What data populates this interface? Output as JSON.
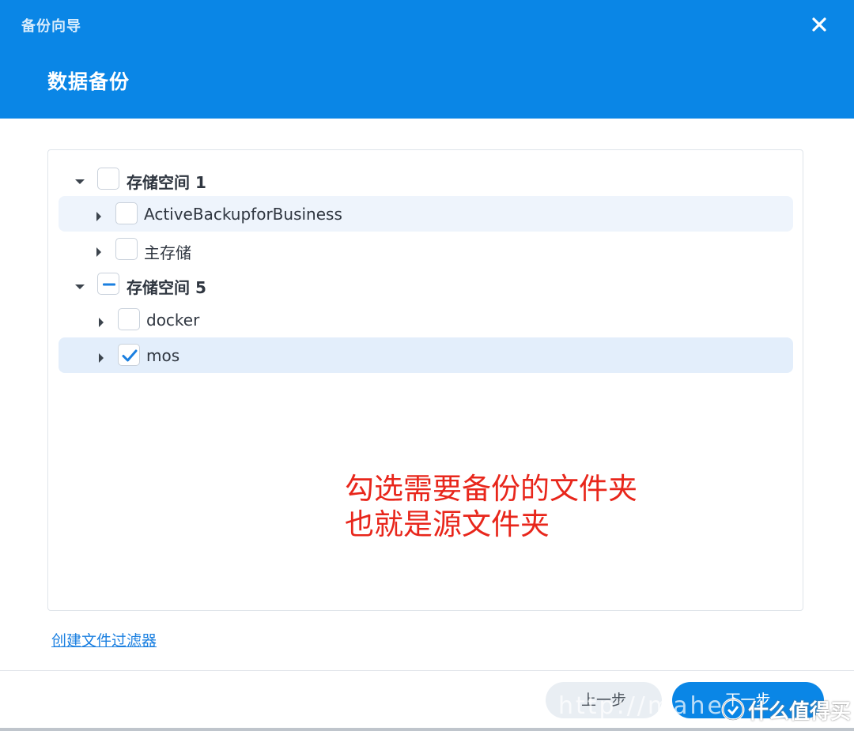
{
  "window": {
    "wizard_title": "备份向导",
    "page_title": "数据备份",
    "close_icon": "close-icon"
  },
  "tree": {
    "groups": [
      {
        "label": "存储空间 1",
        "expanded": true,
        "check_state": "unchecked",
        "children": [
          {
            "label": "ActiveBackupforBusiness",
            "check_state": "unchecked",
            "highlighted": true
          },
          {
            "label": "主存储",
            "check_state": "unchecked",
            "highlighted": false
          }
        ]
      },
      {
        "label": "存储空间 5",
        "expanded": true,
        "check_state": "partial",
        "children": [
          {
            "label": "docker",
            "check_state": "unchecked",
            "highlighted": false
          },
          {
            "label": "mos",
            "check_state": "checked",
            "highlighted": true
          }
        ]
      }
    ]
  },
  "annotation": {
    "line1": "勾选需要备份的文件夹",
    "line2": "也就是源文件夹",
    "color": "#e8261b"
  },
  "links": {
    "create_filter": "创建文件过滤器"
  },
  "buttons": {
    "prev": "上一步",
    "next": "下一步"
  },
  "watermark": {
    "url_text": "http://mahe",
    "brand": "什么值得买"
  },
  "colors": {
    "header": "#0a86e6",
    "accent": "#1a7fe0"
  }
}
